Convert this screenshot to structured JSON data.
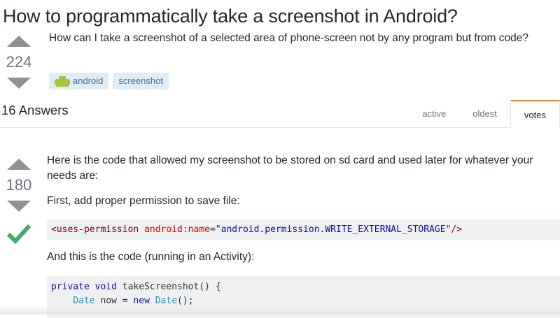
{
  "question": {
    "title": "How to programmatically take a screenshot in Android?",
    "votes": "224",
    "body": "How can I take a screenshot of a selected area of phone-screen not by any program but from code?",
    "tags": [
      {
        "label": "android",
        "icon": "android-icon"
      },
      {
        "label": "screenshot"
      }
    ]
  },
  "answers_header": {
    "count_label": "16 Answers",
    "tabs": [
      {
        "label": "active",
        "selected": false
      },
      {
        "label": "oldest",
        "selected": false
      },
      {
        "label": "votes",
        "selected": true
      }
    ]
  },
  "answer": {
    "votes": "180",
    "accepted": true,
    "intro": "Here is the code that allowed my screenshot to be stored on sd card and used later for whatever your needs are:",
    "step1": "First, add proper permission to save file:",
    "permission_code": {
      "open": "<",
      "tag": "uses-permission",
      "attr": "android:name",
      "equals": "=",
      "value": "\"android.permission.WRITE_EXTERNAL_STORAGE\"",
      "close": "/>"
    },
    "step2": "And this is the code (running in an Activity):",
    "code_lines": {
      "line1": {
        "kw": "private",
        "type": "void",
        "rest": " takeScreenshot() {"
      },
      "line2": {
        "indent": "    ",
        "type": "Date",
        "mid": " now = ",
        "kw": "new",
        "type2": "Date",
        "rest": "();"
      }
    }
  },
  "colors": {
    "accent_tab": "#f48024",
    "tag_bg": "#e1ecf4",
    "tag_text": "#39739d",
    "accepted_check": "#48a868",
    "vote_arrow": "#8c9296"
  }
}
